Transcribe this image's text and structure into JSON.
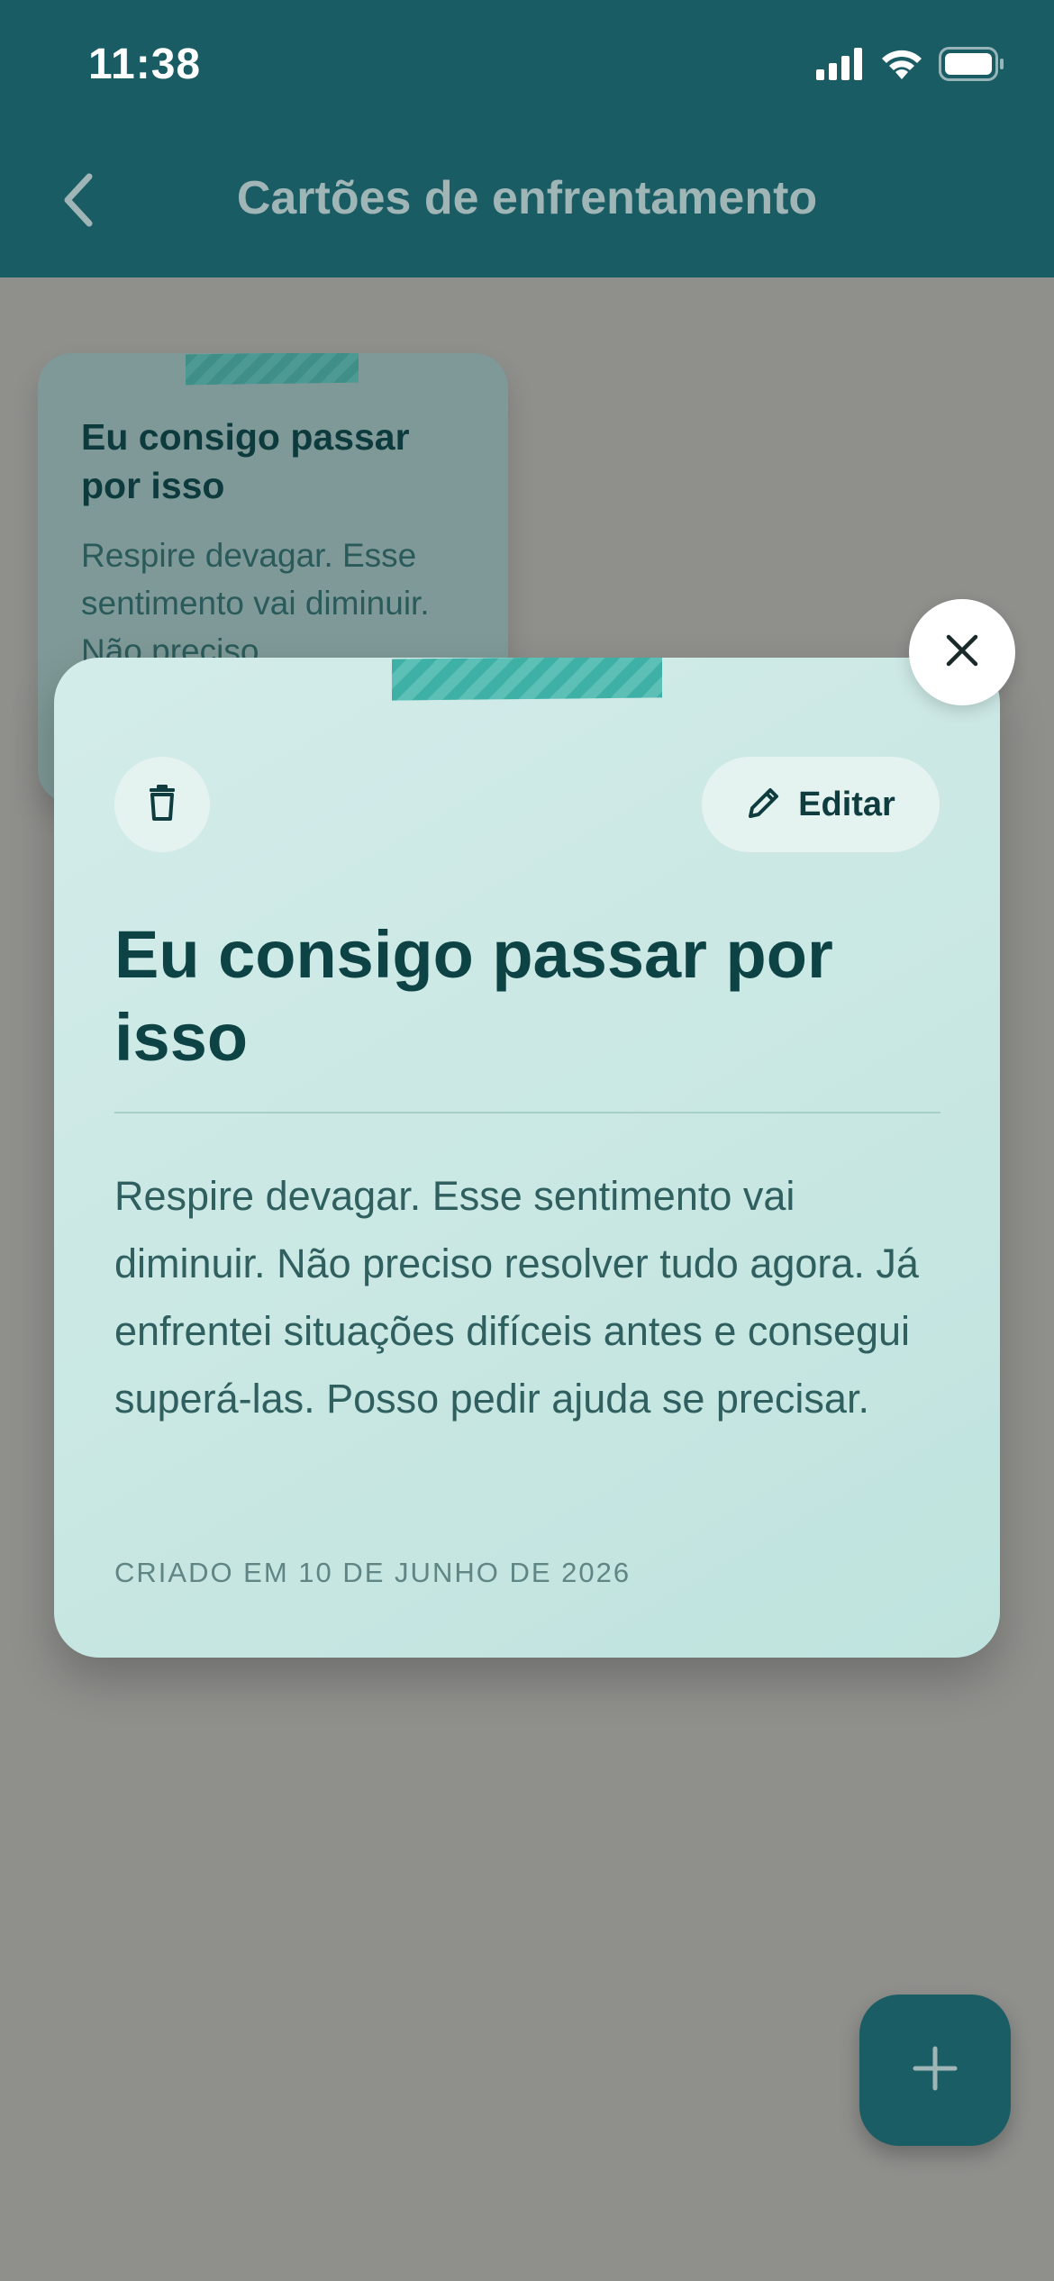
{
  "status_bar": {
    "time": "11:38",
    "signal_icon": "cellular-signal-icon",
    "wifi_icon": "wifi-icon",
    "battery_icon": "battery-icon"
  },
  "header": {
    "back_icon": "chevron-left-icon",
    "title": "Cartões de enfrentamento"
  },
  "cards": [
    {
      "title": "Eu consigo passar por isso",
      "preview": "Respire devagar. Esse sentimento vai diminuir. Não preciso"
    }
  ],
  "modal": {
    "delete_icon": "trash-icon",
    "edit_icon": "pencil-icon",
    "edit_label": "Editar",
    "title": "Eu consigo passar por isso",
    "body": "Respire devagar. Esse sentimento vai diminuir. Não preciso resolver tudo agora. Já enfrentei situações difíceis antes e consegui superá-las. Posso pedir ajuda se precisar.",
    "created": "CRIADO EM 10 DE JUNHO DE 2026",
    "close_icon": "close-icon"
  },
  "fab": {
    "icon": "plus-icon"
  },
  "colors": {
    "header_bg": "#1a5c63",
    "overlay_bg": "#8f8f8c",
    "card_bg": "#c9e7e3",
    "tape": "#3fb0a6",
    "title_text": "#0d4345",
    "fab_bg": "#1a5d64"
  }
}
